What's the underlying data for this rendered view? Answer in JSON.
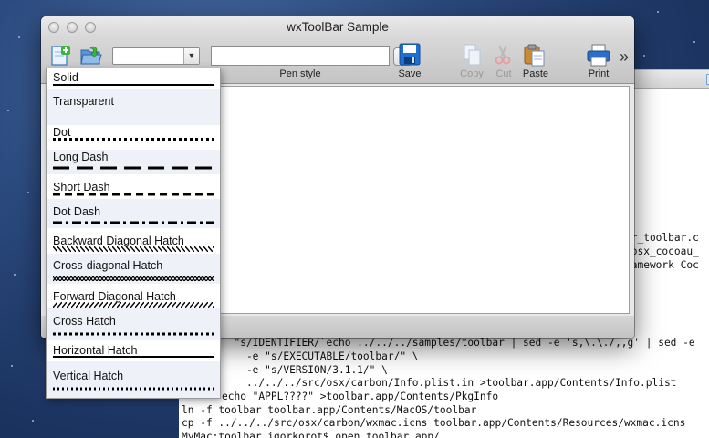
{
  "window": {
    "title": "wxToolBar Sample"
  },
  "toolbar": {
    "pen_style_label": "Pen style",
    "save_label": "Save",
    "copy_label": "Copy",
    "cut_label": "Cut",
    "paste_label": "Paste",
    "print_label": "Print",
    "more_glyph": "»",
    "combo1_value": "",
    "combo2_value": "",
    "dropdown_arrow": "▼"
  },
  "pen_style_list": [
    {
      "label": "Solid",
      "style": "solid"
    },
    {
      "label": "Transparent",
      "style": "none"
    },
    {
      "label": "Dot",
      "style": "dot"
    },
    {
      "label": "Long Dash",
      "style": "long-dash"
    },
    {
      "label": "Short Dash",
      "style": "short-dash"
    },
    {
      "label": "Dot Dash",
      "style": "dot-dash"
    },
    {
      "label": "Backward Diagonal Hatch",
      "style": "backward-hatch"
    },
    {
      "label": "Cross-diagonal Hatch",
      "style": "cross-hatch-diag"
    },
    {
      "label": "Forward Diagonal Hatch",
      "style": "forward-hatch"
    },
    {
      "label": "Cross Hatch",
      "style": "cross-hatch"
    },
    {
      "label": "Horizontal Hatch",
      "style": "horizontal-hatch"
    },
    {
      "label": "Vertical Hatch",
      "style": "vertical-hatch"
    }
  ],
  "terminal": {
    "right_fragments": [
      "ar_toolbar.c",
      "_osx_cocoau_",
      "ramework Coc"
    ],
    "lines": [
      "  \"s/IDENTIFIER/`echo ../../../samples/toolbar | sed -e 's,\\.\\./,,g' | sed -e",
      "    -e \"s/EXECUTABLE/toolbar/\" \\",
      "    -e \"s/VERSION/3.1.1/\" \\",
      "    ../../../src/osx/carbon/Info.plist.in >toolbar.app/Contents/Info.plist",
      "echo \"APPL????\" >toolbar.app/Contents/PkgInfo",
      "ln -f toolbar toolbar.app/Contents/MacOS/toolbar",
      "cp -f ../../../src/osx/carbon/wxmac.icns toolbar.app/Contents/Resources/wxmac.icns",
      "MyMac:toolbar igorkorot$ open toolbar.app/"
    ]
  },
  "colors": {
    "accent_blue": "#2f7ed8",
    "desktop": "#1c3461"
  }
}
